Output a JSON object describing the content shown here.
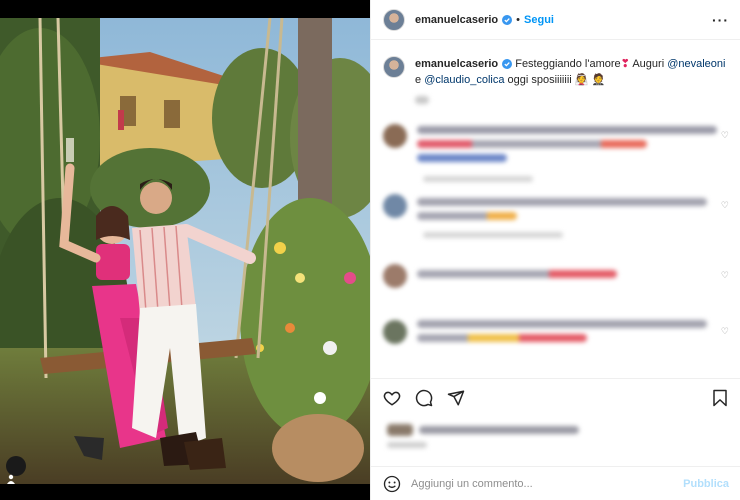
{
  "post": {
    "username": "emanuelcaserio",
    "follow_label": "Segui",
    "more_icon": "ellipsis-icon"
  },
  "caption": {
    "username": "emanuelcaserio",
    "text_part1": "Festeggiando l'amore",
    "emoji_heart": "❣",
    "text_part2": " Auguri ",
    "mention1": "@nevaleoni",
    "text_part3": "e ",
    "mention2": "@claudio_colica",
    "text_part4": " oggi sposiiiiiii ",
    "emoji_people": "👰 🤵"
  },
  "comments": [
    {
      "avatar_color": "#8a6b55"
    },
    {
      "avatar_color": "#7088a6"
    },
    {
      "avatar_color": "#9c7b6a"
    },
    {
      "avatar_color": "#6b7560"
    }
  ],
  "actions": {
    "like_icon": "heart-outline-icon",
    "comment_icon": "comment-bubble-icon",
    "share_icon": "paper-plane-icon",
    "save_icon": "bookmark-icon"
  },
  "add_comment": {
    "placeholder": "Aggiungi un commento...",
    "publish_label": "Pubblica"
  },
  "colors": {
    "accent": "#0095f6",
    "mention": "#00376b",
    "publish_disabled": "#b2dffc",
    "dress": "#e0307a"
  }
}
